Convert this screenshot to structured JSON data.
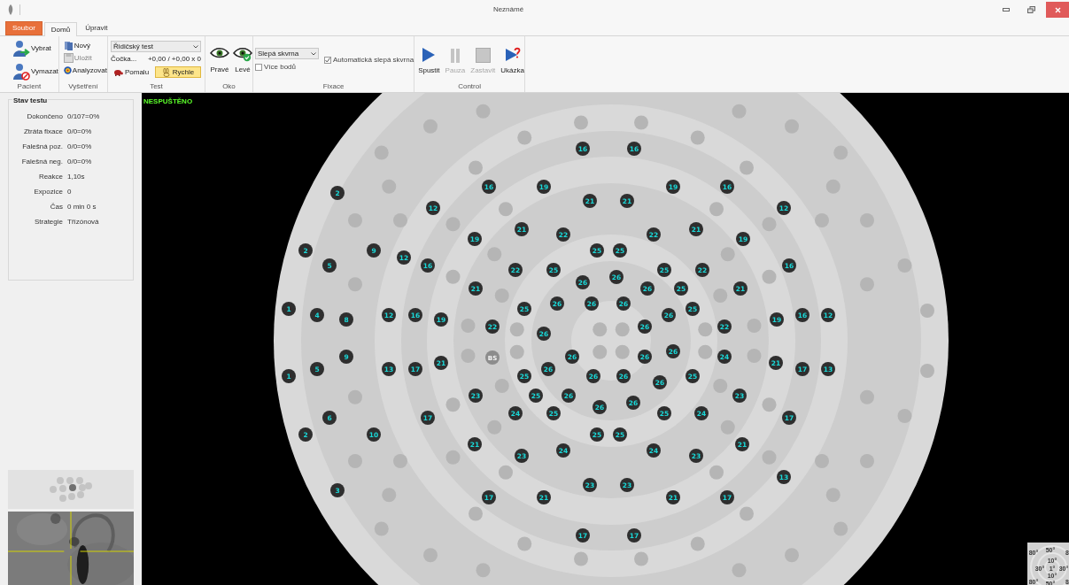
{
  "window": {
    "title": "Neznámé"
  },
  "ribbon_tabs": [
    {
      "label": "Soubor",
      "kind": "file",
      "selected": false
    },
    {
      "label": "Domů",
      "kind": "tab",
      "selected": true
    },
    {
      "label": "Úpravit",
      "kind": "tab",
      "selected": false
    }
  ],
  "ribbon": {
    "patient": {
      "label": "Pacient",
      "buttons": [
        {
          "label": "Vybrat"
        },
        {
          "label": "Vymazat"
        }
      ]
    },
    "exam": {
      "label": "Vyšetření",
      "buttons": [
        {
          "label": "Nový",
          "disabled": false
        },
        {
          "label": "Uložit",
          "disabled": true
        },
        {
          "label": "Analyzovat",
          "disabled": false
        }
      ]
    },
    "test": {
      "label": "Test",
      "dropdown": {
        "value": "Řidičský test"
      },
      "lens_label": "Čočka...",
      "lens_value": "+0,00 / +0,00 x 0",
      "speeds": [
        {
          "label": "Pomalu",
          "selected": false
        },
        {
          "label": "Rychle",
          "selected": true
        }
      ]
    },
    "eye": {
      "label": "Oko",
      "eyes": [
        {
          "label": "Pravé",
          "selected": false
        },
        {
          "label": "Levé",
          "selected": true
        }
      ]
    },
    "fixation": {
      "label": "Fixace",
      "dropdown": {
        "value": "Slepá skvrna"
      },
      "checkboxes": [
        {
          "label": "Více bodů",
          "checked": false
        },
        {
          "label": "Automatická slepá skvrna",
          "checked": true
        }
      ]
    },
    "control": {
      "label": "Control",
      "buttons": [
        {
          "label": "Spustit",
          "disabled": false
        },
        {
          "label": "Pauza",
          "disabled": true
        },
        {
          "label": "Zastavit",
          "disabled": true
        },
        {
          "label": "Ukázka",
          "disabled": false
        }
      ]
    }
  },
  "status_panel": {
    "title": "Stav testu",
    "rows": [
      {
        "label": "Dokončeno",
        "value": "0/107=0%"
      },
      {
        "label": "Ztráta fixace",
        "value": "0/0=0%"
      },
      {
        "label": "Falešná poz.",
        "value": "0/0=0%"
      },
      {
        "label": "Falešná neg.",
        "value": "0/0=0%"
      },
      {
        "label": "Reakce",
        "value": "1,10s"
      },
      {
        "label": "Expozice",
        "value": "0"
      },
      {
        "label": "Čas",
        "value": "0 min 0 s"
      },
      {
        "label": "Strategie",
        "value": "Třízónová"
      }
    ]
  },
  "field": {
    "status": "NESPUŠTĚNO",
    "blind_spot": {
      "label": "BS"
    },
    "points": [
      "16",
      "16",
      "16",
      "19",
      "19",
      "16",
      "2",
      "21",
      "21",
      "12",
      "12",
      "21",
      "21",
      "22",
      "22",
      "19",
      "19",
      "2",
      "9",
      "25",
      "25",
      "12",
      "5",
      "16",
      "16",
      "22",
      "25",
      "25",
      "22",
      "26",
      "26",
      "21",
      "26",
      "25",
      "21",
      "26",
      "26",
      "26",
      "1",
      "25",
      "25",
      "4",
      "12",
      "16",
      "26",
      "16",
      "12",
      "8",
      "19",
      "19",
      "22",
      "26",
      "22",
      "26",
      "26",
      "9",
      "26",
      "26",
      "24",
      "21",
      "21",
      "5",
      "13",
      "17",
      "26",
      "17",
      "13",
      "1",
      "25",
      "26",
      "26",
      "25",
      "26",
      "23",
      "25",
      "26",
      "23",
      "26",
      "26",
      "24",
      "25",
      "25",
      "24",
      "6",
      "17",
      "17",
      "2",
      "10",
      "25",
      "25",
      "21",
      "21",
      "24",
      "24",
      "23",
      "23",
      "13",
      "23",
      "23",
      "3",
      "17",
      "21",
      "21",
      "17",
      "17",
      "17"
    ],
    "scale_labels": [
      "80°",
      "50°",
      "8",
      "10°",
      "30°",
      "1°",
      "30°",
      "10°",
      "80°",
      "50°",
      "8"
    ]
  }
}
